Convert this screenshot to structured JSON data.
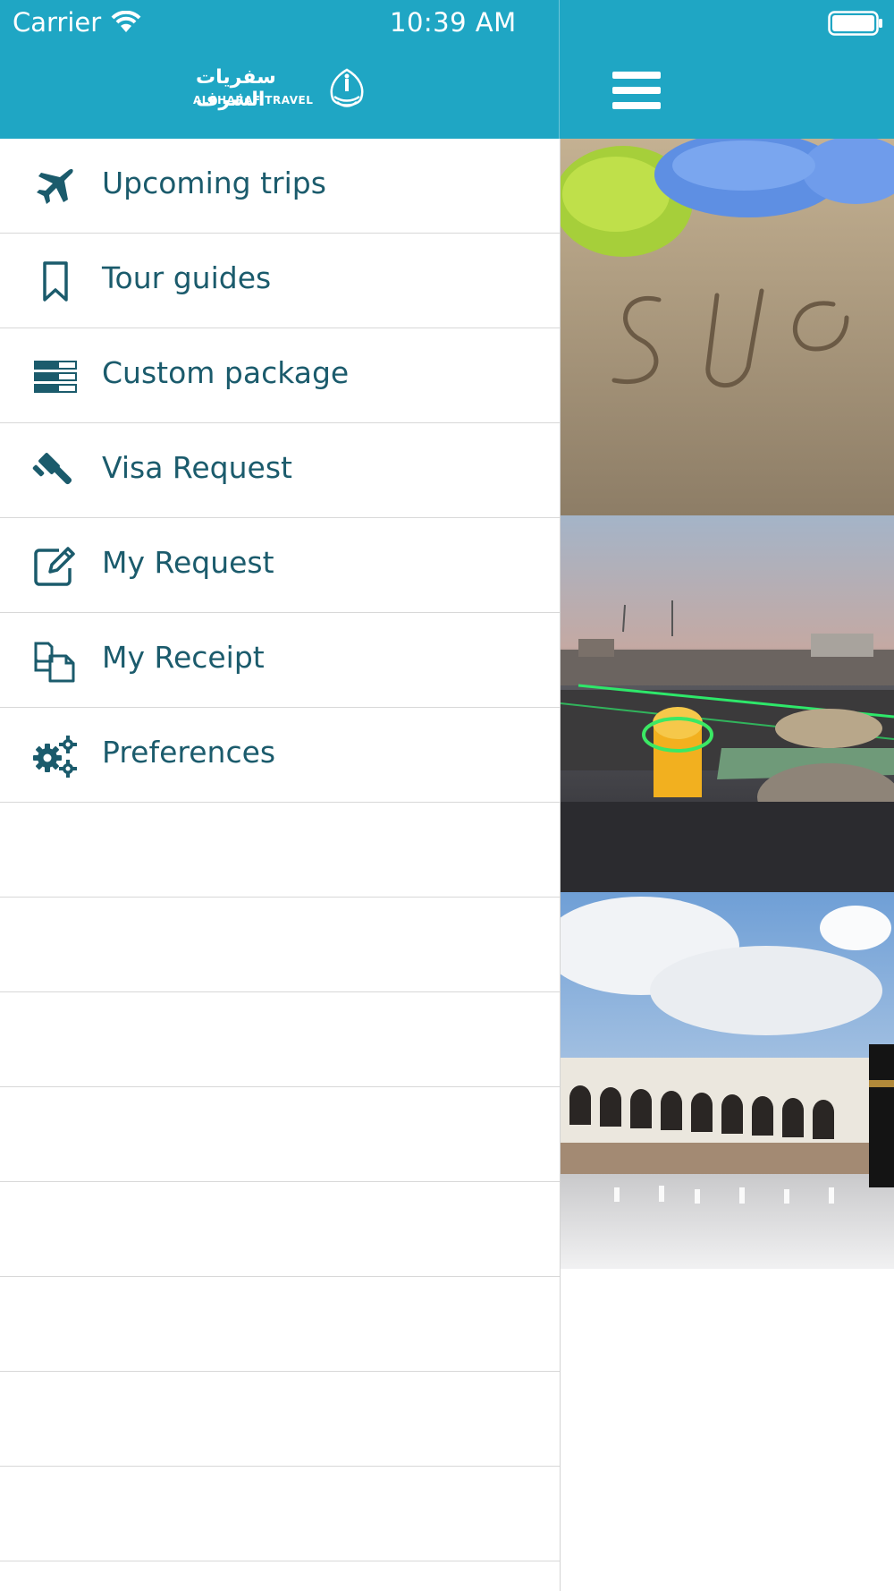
{
  "status_bar": {
    "carrier": "Carrier",
    "time": "10:39 AM"
  },
  "header": {
    "logo_arabic": "سفريات الشرف",
    "logo_english": "ALSHARAF TRAVEL"
  },
  "menu": {
    "items": [
      {
        "label": "Upcoming trips",
        "icon": "airplane-icon"
      },
      {
        "label": "Tour guides",
        "icon": "bookmark-icon"
      },
      {
        "label": "Custom package",
        "icon": "package-list-icon"
      },
      {
        "label": "Visa Request",
        "icon": "gavel-icon"
      },
      {
        "label": "My Request",
        "icon": "edit-icon"
      },
      {
        "label": "My Receipt",
        "icon": "documents-icon"
      },
      {
        "label": "Preferences",
        "icon": "gears-icon"
      }
    ]
  },
  "colors": {
    "header": "#1fa6c4",
    "menu_text": "#1b5b6c",
    "icon": "#1b5b6c",
    "divider": "#d8d8d8"
  }
}
